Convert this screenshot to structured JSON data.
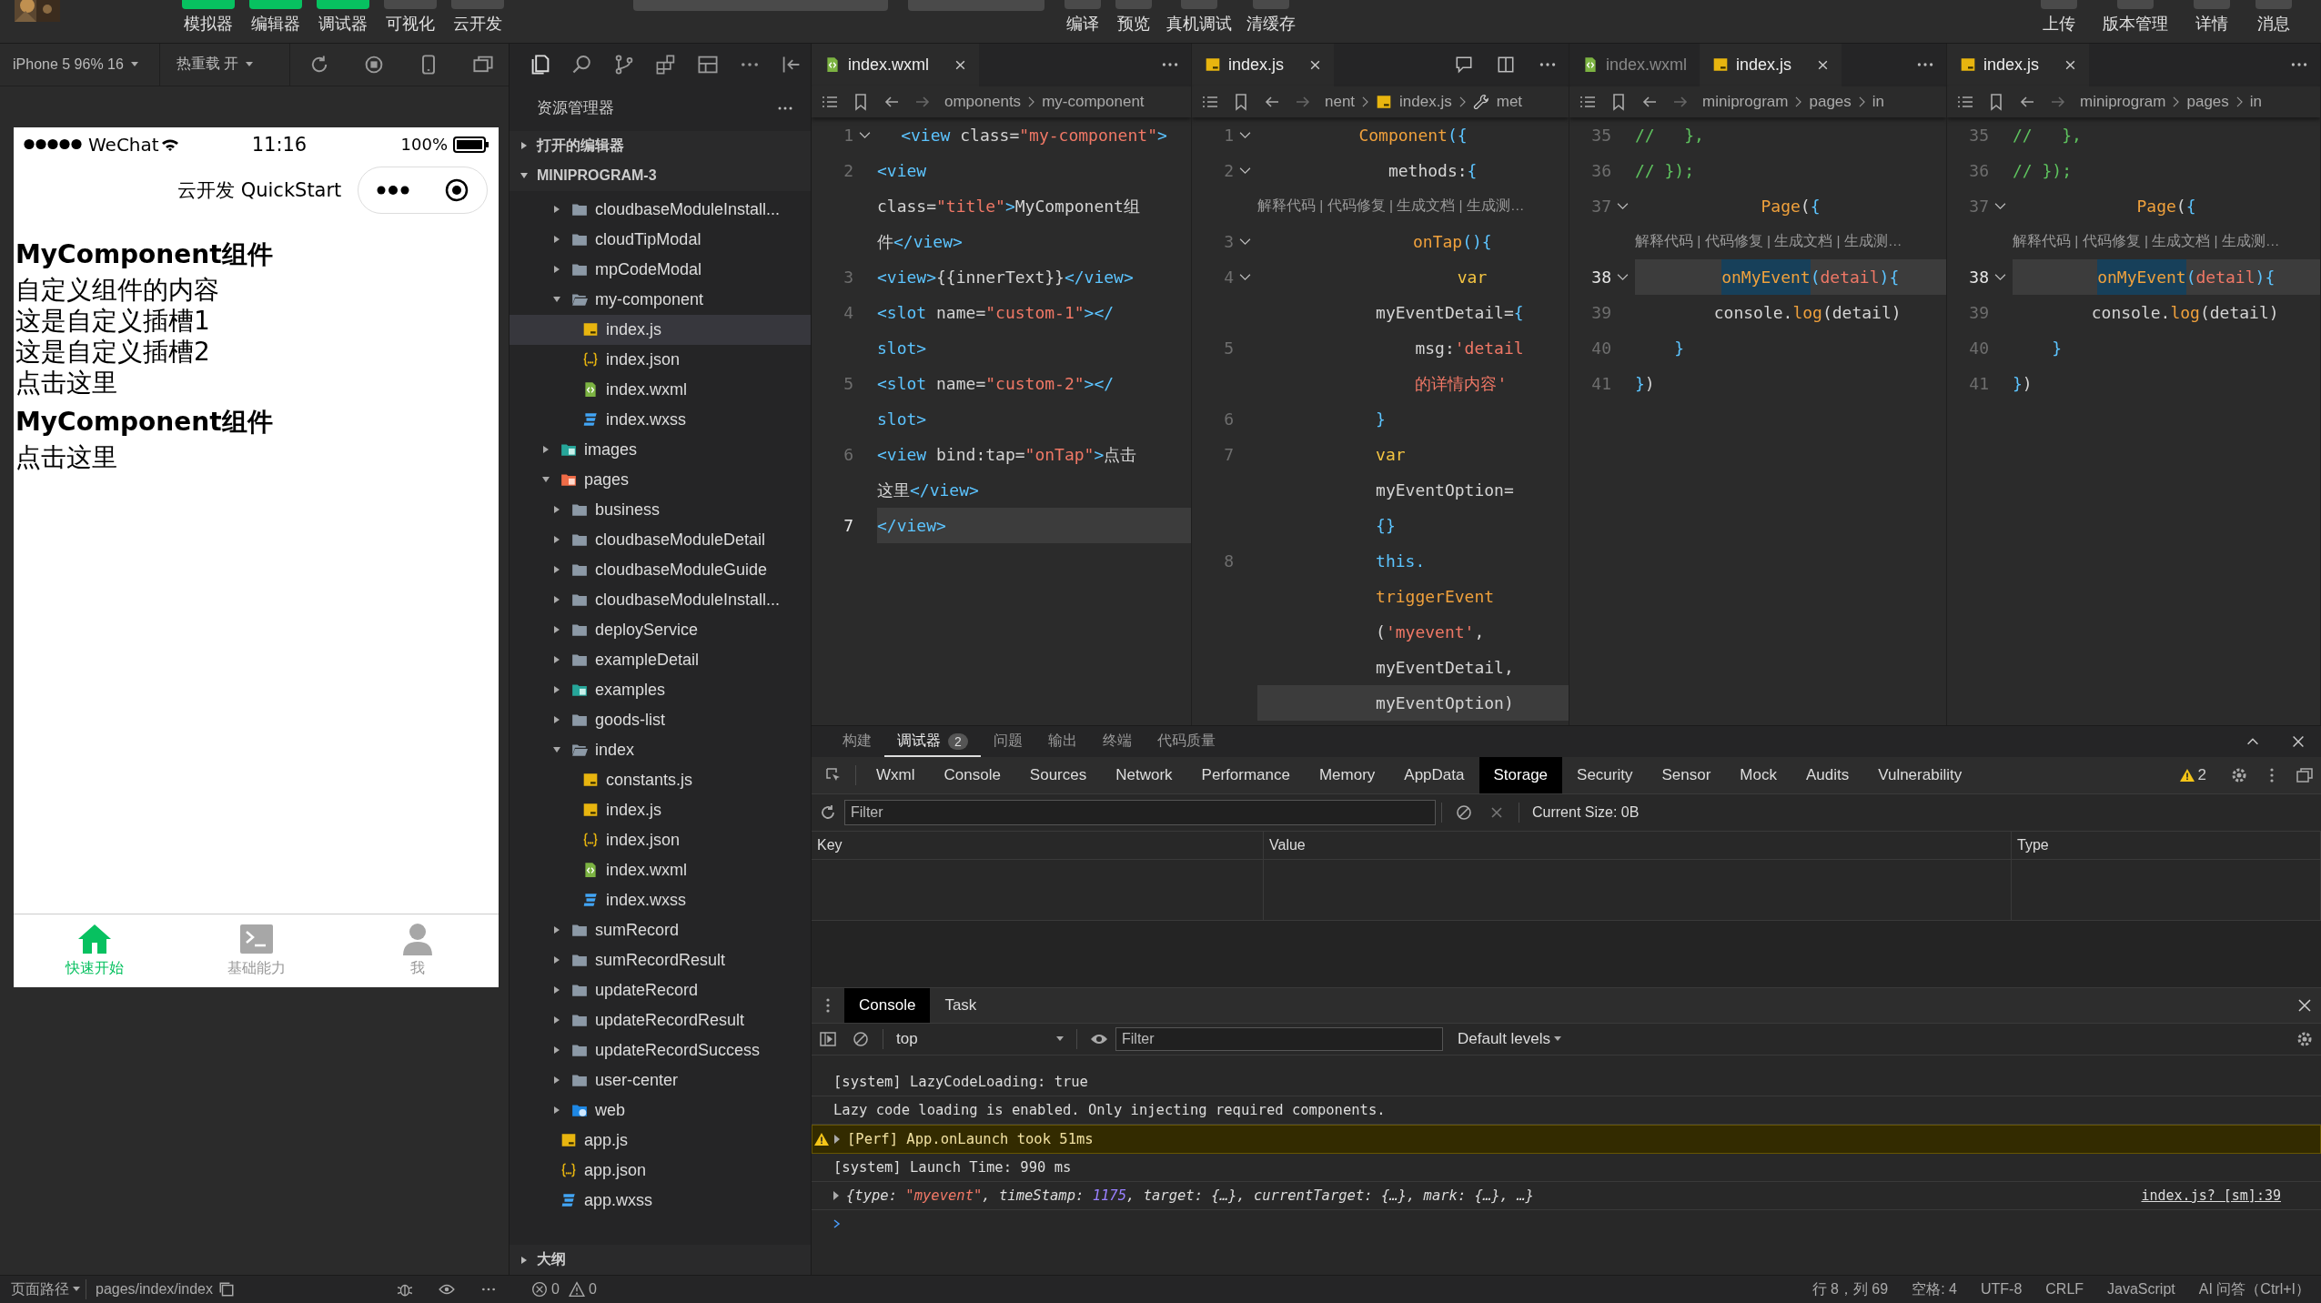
{
  "toolbar": {
    "left_buttons": [
      {
        "label": "模拟器",
        "on": true
      },
      {
        "label": "编辑器",
        "on": true
      },
      {
        "label": "调试器",
        "on": true
      },
      {
        "label": "可视化",
        "on": false
      },
      {
        "label": "云开发",
        "on": false
      }
    ],
    "center_buttons": [
      "编译",
      "预览",
      "真机调试",
      "清缓存"
    ],
    "right_buttons": [
      "上传",
      "版本管理",
      "详情",
      "消息"
    ]
  },
  "simulator": {
    "device": "iPhone 5 96% 16",
    "hot_reload": "热重载 开",
    "phone": {
      "carrier": "WeChat",
      "time": "11:16",
      "battery": "100%",
      "nav_title": "云开发 QuickStart",
      "content": [
        {
          "kind": "heading",
          "text": "MyComponent组件"
        },
        {
          "kind": "text",
          "text": "自定义组件的内容"
        },
        {
          "kind": "text",
          "text": "这是自定义插槽1"
        },
        {
          "kind": "text",
          "text": "这是自定义插槽2"
        },
        {
          "kind": "text",
          "text": "点击这里"
        },
        {
          "kind": "heading",
          "text": "MyComponent组件"
        },
        {
          "kind": "text",
          "text": "点击这里"
        }
      ],
      "tabbar": [
        {
          "label": "快速开始",
          "kind": "home",
          "selected": true
        },
        {
          "label": "基础能力",
          "kind": "terminal",
          "selected": false
        },
        {
          "label": "我",
          "kind": "person",
          "selected": false
        }
      ]
    }
  },
  "explorer": {
    "title": "资源管理器",
    "sections": [
      {
        "label": "打开的编辑器",
        "expanded": false
      },
      {
        "label": "MINIPROGRAM-3",
        "expanded": true,
        "tree": [
          {
            "children": [
              {
                "label": "cloudbaseModuleInstall...",
                "kind": "folder",
                "expanded": false,
                "selected": false
              },
              {
                "label": "cloudTipModal",
                "kind": "folder",
                "expanded": false,
                "selected": false
              },
              {
                "label": "mpCodeModal",
                "kind": "folder",
                "expanded": false,
                "selected": false
              },
              {
                "label": "my-component",
                "kind": "folder",
                "expanded": true,
                "selected": false,
                "children": [
                  {
                    "label": "index.js",
                    "kind": "js",
                    "selected": true
                  },
                  {
                    "label": "index.json",
                    "kind": "json",
                    "selected": false
                  },
                  {
                    "label": "index.wxml",
                    "kind": "wxml",
                    "selected": false
                  },
                  {
                    "label": "index.wxss",
                    "kind": "wxss",
                    "selected": false
                  }
                ]
              }
            ]
          },
          {
            "label": "images",
            "kind": "images",
            "expanded": false,
            "selected": false
          },
          {
            "label": "pages",
            "kind": "pages",
            "expanded": true,
            "selected": false,
            "children": [
              {
                "label": "business",
                "kind": "folder",
                "expanded": false,
                "selected": false
              },
              {
                "label": "cloudbaseModuleDetail",
                "kind": "folder",
                "expanded": false,
                "selected": false
              },
              {
                "label": "cloudbaseModuleGuide",
                "kind": "folder",
                "expanded": false,
                "selected": false
              },
              {
                "label": "cloudbaseModuleInstall...",
                "kind": "folder",
                "expanded": false,
                "selected": false
              },
              {
                "label": "deployService",
                "kind": "folder",
                "expanded": false,
                "selected": false
              },
              {
                "label": "exampleDetail",
                "kind": "folder",
                "expanded": false,
                "selected": false
              },
              {
                "label": "examples",
                "kind": "images",
                "expanded": false,
                "selected": false
              },
              {
                "label": "goods-list",
                "kind": "folder",
                "expanded": false,
                "selected": false
              },
              {
                "label": "index",
                "kind": "folder",
                "expanded": true,
                "selected": false,
                "children": [
                  {
                    "label": "constants.js",
                    "kind": "js",
                    "selected": false
                  },
                  {
                    "label": "index.js",
                    "kind": "js",
                    "selected": false
                  },
                  {
                    "label": "index.json",
                    "kind": "json",
                    "selected": false
                  },
                  {
                    "label": "index.wxml",
                    "kind": "wxml",
                    "selected": false
                  },
                  {
                    "label": "index.wxss",
                    "kind": "wxss",
                    "selected": false
                  }
                ]
              },
              {
                "label": "sumRecord",
                "kind": "folder",
                "expanded": false,
                "selected": false
              },
              {
                "label": "sumRecordResult",
                "kind": "folder",
                "expanded": false,
                "selected": false
              },
              {
                "label": "updateRecord",
                "kind": "folder",
                "expanded": false,
                "selected": false
              },
              {
                "label": "updateRecordResult",
                "kind": "folder",
                "expanded": false,
                "selected": false
              },
              {
                "label": "updateRecordSuccess",
                "kind": "folder",
                "expanded": false,
                "selected": false
              },
              {
                "label": "user-center",
                "kind": "folder",
                "expanded": false,
                "selected": false
              },
              {
                "label": "web",
                "kind": "web",
                "expanded": false,
                "selected": false
              }
            ]
          },
          {
            "label": "app.js",
            "kind": "js",
            "selected": false
          },
          {
            "label": "app.json",
            "kind": "json",
            "selected": false
          },
          {
            "label": "app.wxss",
            "kind": "wxss",
            "selected": false
          }
        ]
      },
      {
        "label": "大纲",
        "expanded": false
      }
    ]
  },
  "editors": [
    {
      "tabs": [
        {
          "label": "index.wxml",
          "kind": "wxml",
          "selected": true
        }
      ],
      "breadcrumb": [
        {
          "text": "omponents"
        },
        {
          "text": "my-component"
        }
      ],
      "lines": [
        {
          "kind": "code",
          "num": "1",
          "fold": true,
          "current": false,
          "tokens": [
            {
              "kind": "tag",
              "text": "<view"
            },
            {
              "kind": "attr",
              "text": " class="
            },
            {
              "kind": "str",
              "text": "\"my-component\""
            },
            {
              "kind": "tag",
              "text": ">"
            }
          ]
        },
        {
          "kind": "code",
          "num": "2",
          "fold": false,
          "current": false,
          "tokens": [
            {
              "kind": "tag",
              "text": "<view"
            }
          ]
        },
        {
          "kind": "code",
          "fold": false,
          "current": false,
          "tokens": [
            {
              "kind": "attr",
              "text": "class="
            },
            {
              "kind": "str",
              "text": "\"title\""
            },
            {
              "kind": "tag",
              "text": ">"
            },
            {
              "kind": "text",
              "text": "MyComponent组"
            }
          ]
        },
        {
          "kind": "code",
          "fold": false,
          "current": false,
          "tokens": [
            {
              "kind": "text",
              "text": "件"
            },
            {
              "kind": "tag",
              "text": "</view>"
            }
          ]
        },
        {
          "kind": "code",
          "num": "3",
          "fold": false,
          "current": false,
          "tokens": [
            {
              "kind": "tag",
              "text": "<view>"
            },
            {
              "kind": "text",
              "text": "{{innerText}}"
            },
            {
              "kind": "tag",
              "text": "</view>"
            }
          ]
        },
        {
          "kind": "code",
          "num": "4",
          "fold": false,
          "current": false,
          "tokens": [
            {
              "kind": "tag",
              "text": "<slot"
            },
            {
              "kind": "attr",
              "text": " name="
            },
            {
              "kind": "str",
              "text": "\"custom-1\""
            },
            {
              "kind": "tag",
              "text": "></"
            }
          ]
        },
        {
          "kind": "code",
          "fold": false,
          "current": false,
          "tokens": [
            {
              "kind": "tag",
              "text": "slot>"
            }
          ]
        },
        {
          "kind": "code",
          "num": "5",
          "fold": false,
          "current": false,
          "tokens": [
            {
              "kind": "tag",
              "text": "<slot"
            },
            {
              "kind": "attr",
              "text": " name="
            },
            {
              "kind": "str",
              "text": "\"custom-2\""
            },
            {
              "kind": "tag",
              "text": "></"
            }
          ]
        },
        {
          "kind": "code",
          "fold": false,
          "current": false,
          "tokens": [
            {
              "kind": "tag",
              "text": "slot>"
            }
          ]
        },
        {
          "kind": "code",
          "num": "6",
          "fold": false,
          "current": false,
          "tokens": [
            {
              "kind": "tag",
              "text": "<view"
            },
            {
              "kind": "attr",
              "text": " bind:tap="
            },
            {
              "kind": "str",
              "text": "\"onTap\""
            },
            {
              "kind": "tag",
              "text": ">"
            },
            {
              "kind": "text",
              "text": "点击"
            }
          ]
        },
        {
          "kind": "code",
          "fold": false,
          "current": false,
          "tokens": [
            {
              "kind": "text",
              "text": "这里"
            },
            {
              "kind": "tag",
              "text": "</view>"
            }
          ]
        },
        {
          "kind": "code",
          "num": "7",
          "fold": false,
          "current": true,
          "tokens": [
            {
              "kind": "tag",
              "text": "</view>"
            }
          ]
        }
      ]
    },
    {
      "tabs": [
        {
          "label": "index.js",
          "kind": "js",
          "selected": true
        }
      ],
      "breadcrumb": [
        {
          "text": "nent"
        },
        {
          "text": "index.js",
          "kind": "js"
        },
        {
          "text": "met",
          "kind": "wrench"
        }
      ],
      "lines": [
        {
          "kind": "code",
          "num": "1",
          "fold": true,
          "current": false,
          "tokens": [
            {
              "kind": "fn",
              "text": "Component"
            },
            {
              "kind": "brace",
              "text": "({"
            }
          ]
        },
        {
          "kind": "code",
          "num": "2",
          "fold": true,
          "current": false,
          "tokens": [
            {
              "kind": "text",
              "text": "    methods:"
            },
            {
              "kind": "brace",
              "text": "{"
            }
          ]
        },
        {
          "kind": "lens",
          "text": "解释代码 | 代码修复 | 生成文档 | 生成测…"
        },
        {
          "kind": "code",
          "num": "3",
          "fold": true,
          "current": false,
          "tokens": [
            {
              "kind": "fn",
              "text": "        onTap"
            },
            {
              "kind": "brace",
              "text": "(){"
            }
          ]
        },
        {
          "kind": "code",
          "num": "4",
          "fold": true,
          "current": false,
          "tokens": [
            {
              "kind": "kw",
              "text": "            var"
            }
          ]
        },
        {
          "kind": "code",
          "fold": false,
          "current": false,
          "tokens": [
            {
              "kind": "text",
              "text": "            myEventDetail="
            },
            {
              "kind": "brace",
              "text": "{"
            }
          ]
        },
        {
          "kind": "code",
          "num": "5",
          "fold": false,
          "current": false,
          "tokens": [
            {
              "kind": "text",
              "text": "                msg:"
            },
            {
              "kind": "str",
              "text": "'detail"
            }
          ]
        },
        {
          "kind": "code",
          "fold": false,
          "current": false,
          "tokens": [
            {
              "kind": "str",
              "text": "                的详情内容'"
            }
          ]
        },
        {
          "kind": "code",
          "num": "6",
          "fold": false,
          "current": false,
          "tokens": [
            {
              "kind": "brace",
              "text": "            }"
            }
          ]
        },
        {
          "kind": "code",
          "num": "7",
          "fold": false,
          "current": false,
          "tokens": [
            {
              "kind": "kw",
              "text": "            var"
            }
          ]
        },
        {
          "kind": "code",
          "fold": false,
          "current": false,
          "tokens": [
            {
              "kind": "text",
              "text": "            myEventOption="
            }
          ]
        },
        {
          "kind": "code",
          "fold": false,
          "current": false,
          "tokens": [
            {
              "kind": "brace",
              "text": "            {}"
            }
          ]
        },
        {
          "kind": "code",
          "num": "8",
          "fold": false,
          "current": false,
          "tokens": [
            {
              "kind": "this",
              "text": "            this."
            }
          ]
        },
        {
          "kind": "code",
          "fold": false,
          "current": false,
          "tokens": [
            {
              "kind": "fn",
              "text": "            triggerEvent"
            }
          ]
        },
        {
          "kind": "code",
          "fold": false,
          "current": false,
          "tokens": [
            {
              "kind": "text",
              "text": "            ("
            },
            {
              "kind": "str",
              "text": "'myevent'"
            },
            {
              "kind": "text",
              "text": ","
            }
          ]
        },
        {
          "kind": "code",
          "fold": false,
          "current": false,
          "tokens": [
            {
              "kind": "text",
              "text": "            myEventDetail,"
            }
          ]
        },
        {
          "kind": "code",
          "fold": false,
          "current": true,
          "tokens": [
            {
              "kind": "text",
              "text": "            myEventOption)"
            }
          ]
        }
      ]
    },
    {
      "tabs": [
        {
          "label": "index.wxml",
          "kind": "wxml",
          "selected": false
        },
        {
          "label": "index.js",
          "kind": "js",
          "selected": true
        }
      ],
      "breadcrumb": [
        {
          "text": "miniprogram"
        },
        {
          "text": "pages"
        },
        {
          "text": "in"
        }
      ],
      "lines": [
        {
          "kind": "code",
          "num": "35",
          "fold": false,
          "current": false,
          "tokens": [
            {
              "kind": "comment",
              "text": "//   },"
            }
          ]
        },
        {
          "kind": "code",
          "num": "36",
          "fold": false,
          "current": false,
          "tokens": [
            {
              "kind": "comment",
              "text": "// });"
            }
          ]
        },
        {
          "kind": "code",
          "num": "37",
          "fold": true,
          "current": false,
          "tokens": [
            {
              "kind": "fn",
              "text": "Page"
            },
            {
              "kind": "text",
              "text": "("
            },
            {
              "kind": "brace",
              "text": "{"
            }
          ]
        },
        {
          "kind": "lens",
          "text": "解释代码 | 代码修复 | 生成文档 | 生成测…"
        },
        {
          "kind": "code",
          "num": "38",
          "fold": true,
          "current": true,
          "tokens": [
            {
              "kind": "fnhl",
              "text": "    onMyEvent"
            },
            {
              "kind": "brace",
              "text": "("
            },
            {
              "kind": "param",
              "text": "detail"
            },
            {
              "kind": "brace",
              "text": "){"
            }
          ]
        },
        {
          "kind": "code",
          "num": "39",
          "fold": false,
          "current": false,
          "tokens": [
            {
              "kind": "text",
              "text": "        console."
            },
            {
              "kind": "fn",
              "text": "log"
            },
            {
              "kind": "text",
              "text": "(detail)"
            }
          ]
        },
        {
          "kind": "code",
          "num": "40",
          "fold": false,
          "current": false,
          "tokens": [
            {
              "kind": "brace",
              "text": "    }"
            }
          ]
        },
        {
          "kind": "code",
          "num": "41",
          "fold": false,
          "current": false,
          "tokens": [
            {
              "kind": "brace",
              "text": "}"
            },
            {
              "kind": "text",
              "text": ")"
            }
          ]
        }
      ]
    },
    {
      "tabs": [
        {
          "label": "index.js",
          "kind": "js",
          "selected": true
        }
      ],
      "breadcrumb": [
        {
          "text": "miniprogram"
        },
        {
          "text": "pages"
        },
        {
          "text": "in"
        }
      ],
      "lines": [
        {
          "kind": "code",
          "num": "35",
          "fold": false,
          "current": false,
          "tokens": [
            {
              "kind": "comment",
              "text": "//   },"
            }
          ]
        },
        {
          "kind": "code",
          "num": "36",
          "fold": false,
          "current": false,
          "tokens": [
            {
              "kind": "comment",
              "text": "// });"
            }
          ]
        },
        {
          "kind": "code",
          "num": "37",
          "fold": true,
          "current": false,
          "tokens": [
            {
              "kind": "fn",
              "text": "Page"
            },
            {
              "kind": "text",
              "text": "("
            },
            {
              "kind": "brace",
              "text": "{"
            }
          ]
        },
        {
          "kind": "lens",
          "text": "解释代码 | 代码修复 | 生成文档 | 生成测…"
        },
        {
          "kind": "code",
          "num": "38",
          "fold": true,
          "current": true,
          "tokens": [
            {
              "kind": "fnhl",
              "text": "    onMyEvent"
            },
            {
              "kind": "brace",
              "text": "("
            },
            {
              "kind": "param",
              "text": "detail"
            },
            {
              "kind": "brace",
              "text": "){"
            }
          ]
        },
        {
          "kind": "code",
          "num": "39",
          "fold": false,
          "current": false,
          "tokens": [
            {
              "kind": "text",
              "text": "        console."
            },
            {
              "kind": "fn",
              "text": "log"
            },
            {
              "kind": "text",
              "text": "(detail)"
            }
          ]
        },
        {
          "kind": "code",
          "num": "40",
          "fold": false,
          "current": false,
          "tokens": [
            {
              "kind": "brace",
              "text": "    }"
            }
          ]
        },
        {
          "kind": "code",
          "num": "41",
          "fold": false,
          "current": false,
          "tokens": [
            {
              "kind": "brace",
              "text": "}"
            },
            {
              "kind": "text",
              "text": ")"
            }
          ]
        }
      ]
    }
  ],
  "panel": {
    "tabs": [
      {
        "label": "构建",
        "selected": false
      },
      {
        "label": "调试器",
        "selected": true,
        "badge": "2"
      },
      {
        "label": "问题",
        "selected": false
      },
      {
        "label": "输出",
        "selected": false
      },
      {
        "label": "终端",
        "selected": false
      },
      {
        "label": "代码质量",
        "selected": false
      }
    ],
    "devtools_tabs": [
      {
        "label": "Wxml",
        "selected": false
      },
      {
        "label": "Console",
        "selected": false
      },
      {
        "label": "Sources",
        "selected": false
      },
      {
        "label": "Network",
        "selected": false
      },
      {
        "label": "Performance",
        "selected": false
      },
      {
        "label": "Memory",
        "selected": false
      },
      {
        "label": "AppData",
        "selected": false
      },
      {
        "label": "Storage",
        "selected": true
      },
      {
        "label": "Security",
        "selected": false
      },
      {
        "label": "Sensor",
        "selected": false
      },
      {
        "label": "Mock",
        "selected": false
      },
      {
        "label": "Audits",
        "selected": false
      },
      {
        "label": "Vulnerability",
        "selected": false
      }
    ],
    "warnings": "2",
    "storage": {
      "filter": {
        "placeholder": "Filter"
      },
      "size": "Current Size: 0B",
      "columns": [
        "Key",
        "Value",
        "Type"
      ]
    },
    "console": {
      "tabs": [
        {
          "label": "Console",
          "selected": true
        },
        {
          "label": "Task",
          "selected": false
        }
      ],
      "context": "top",
      "filter": {
        "placeholder": "Filter"
      },
      "levels": "Default levels",
      "messages": [
        {
          "kind": "log",
          "expandable": false,
          "tokens": [
            {
              "kind": "text",
              "text": "[system] LazyCodeLoading: true"
            }
          ]
        },
        {
          "kind": "log",
          "expandable": false,
          "tokens": [
            {
              "kind": "text",
              "text": "Lazy code loading is enabled. Only injecting required components."
            }
          ]
        },
        {
          "kind": "warn",
          "expandable": true,
          "tokens": [
            {
              "kind": "text",
              "text": "[Perf] App.onLaunch took 51ms"
            }
          ]
        },
        {
          "kind": "log",
          "expandable": false,
          "tokens": [
            {
              "kind": "text",
              "text": "[system] Launch Time: 990 ms"
            }
          ]
        },
        {
          "kind": "object",
          "expandable": true,
          "source": "index.js? [sm]:39",
          "tokens": [
            {
              "kind": "text",
              "text": "{type: "
            },
            {
              "kind": "str",
              "text": "\"myevent\""
            },
            {
              "kind": "text",
              "text": ", timeStamp: "
            },
            {
              "kind": "num",
              "text": "1175"
            },
            {
              "kind": "text",
              "text": ", target: {…}, currentTarget: {…}, mark: {…}, …}"
            }
          ]
        }
      ]
    }
  },
  "status_bar": {
    "path_label": "页面路径",
    "path": "pages/index/index",
    "errors": "0",
    "warnings": "0",
    "items": [
      "行 8，列 69",
      "空格: 4",
      "UTF-8",
      "CRLF",
      "JavaScript",
      "AI 问答（Ctrl+I）"
    ]
  }
}
